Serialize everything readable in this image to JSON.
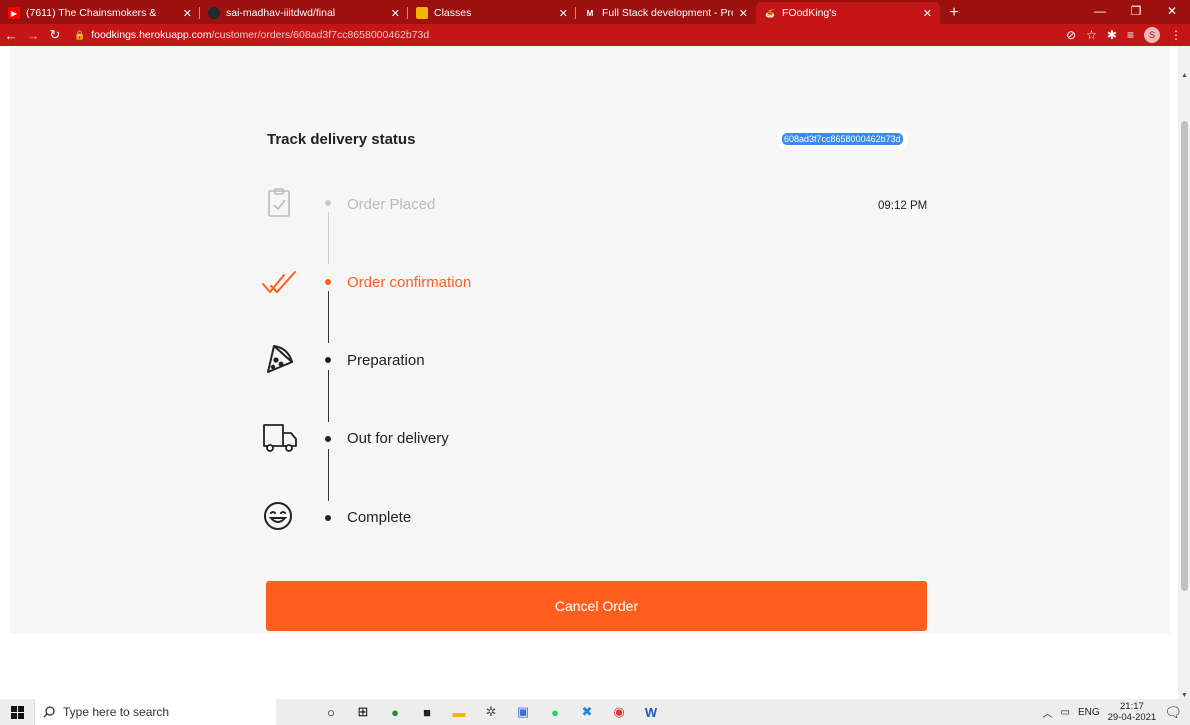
{
  "browser": {
    "tabs": [
      {
        "title": "(7611) The Chainsmokers & ",
        "favicon_color": "#ff0000"
      },
      {
        "title": "sai-madhav-iiitdwd/final",
        "favicon_color": "#24292e"
      },
      {
        "title": "Classes",
        "favicon_color": "#f4b400"
      },
      {
        "title": "Full Stack development - Project",
        "favicon_color": "#ea4335"
      },
      {
        "title": "FOodKing's",
        "favicon_color": "#fe5f1e"
      }
    ],
    "url_host": "foodkings.herokuapp.com",
    "url_path": "/customer/orders/608ad3f7cc8658000462b73d",
    "profile_initial": "S",
    "chrome_color": "#c41616"
  },
  "tracker": {
    "title": "Track delivery status",
    "order_id": "608ad3f7cc8658000462b73d",
    "time": "09:12 PM",
    "steps": [
      {
        "label": "Order Placed",
        "icon": "clipboard-check-icon",
        "state": "done"
      },
      {
        "label": "Order confirmation",
        "icon": "double-check-icon",
        "state": "current"
      },
      {
        "label": "Preparation",
        "icon": "pizza-slice-icon",
        "state": "pending"
      },
      {
        "label": "Out for delivery",
        "icon": "delivery-truck-icon",
        "state": "pending"
      },
      {
        "label": "Complete",
        "icon": "smiley-icon",
        "state": "pending"
      }
    ],
    "cancel_label": "Cancel Order",
    "accent": "#fe5f1e"
  },
  "taskbar": {
    "search_placeholder": "Type here to search",
    "language": "ENG",
    "time": "21:17",
    "date": "29-04-2021"
  }
}
